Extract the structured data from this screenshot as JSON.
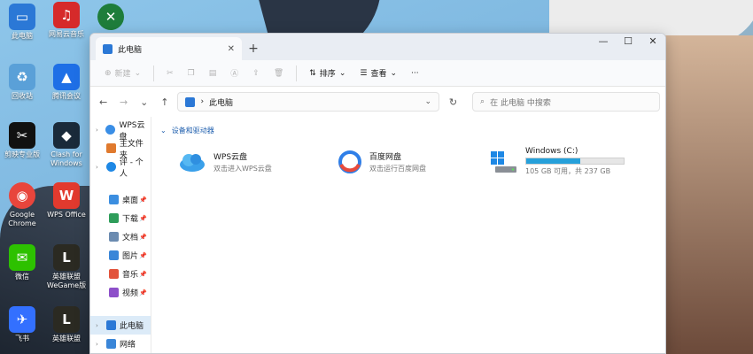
{
  "desktop": {
    "icons": [
      {
        "label": "此电脑",
        "icon": "computer-icon",
        "color": "#2b78d6"
      },
      {
        "label": "网易云音乐",
        "icon": "netease-music-icon",
        "color": "#d62a2a"
      },
      {
        "label": "",
        "icon": "game-app-icon",
        "color": "#1e7d3b"
      },
      {
        "label": "回收站",
        "icon": "recycle-bin-icon",
        "color": "#5aa0d8"
      },
      {
        "label": "腾讯会议",
        "icon": "tencent-meeting-icon",
        "color": "#1e6fe6"
      },
      {
        "label": "剪映专业版",
        "icon": "capcut-icon",
        "color": "#111111"
      },
      {
        "label": "Clash for Windows",
        "icon": "clash-cat-icon",
        "color": "#1a2a3a"
      },
      {
        "label": "Google Chrome",
        "icon": "chrome-icon",
        "color": "#e8453c"
      },
      {
        "label": "WPS Office",
        "icon": "wps-office-icon",
        "color": "#e23a2e"
      },
      {
        "label": "微信",
        "icon": "wechat-icon",
        "color": "#2dc100"
      },
      {
        "label": "英雄联盟WeGame版",
        "icon": "lol-wegame-icon",
        "color": "#2b2a22"
      },
      {
        "label": "飞书",
        "icon": "feishu-icon",
        "color": "#3370ff"
      },
      {
        "label": "英雄联盟",
        "icon": "lol-icon",
        "color": "#2b2a22"
      }
    ]
  },
  "window": {
    "tab_title": "此电脑",
    "tab_close": "✕",
    "new_tab": "+",
    "controls": {
      "minimize": "—",
      "maximize": "☐",
      "close": "✕"
    }
  },
  "commandbar": {
    "new_label": "新建",
    "sort_label": "排序",
    "view_label": "查看",
    "more": "···"
  },
  "address": {
    "path": "此电脑",
    "search_placeholder": "在 此电脑 中搜索"
  },
  "nav": {
    "top": [
      {
        "label": "WPS云盘",
        "icon": "wps-cloud-icon",
        "color": "#3a8ee6",
        "arrow": true
      },
      {
        "label": "主文件夹",
        "icon": "home-icon",
        "color": "#e07a2e",
        "arrow": false
      },
      {
        "label": "评 - 个人",
        "icon": "onedrive-icon",
        "color": "#1e88e5",
        "arrow": true
      }
    ],
    "quick": [
      {
        "label": "桌面",
        "icon": "desktop-icon",
        "color": "#3b8ee0"
      },
      {
        "label": "下载",
        "icon": "download-icon",
        "color": "#2e9d5a"
      },
      {
        "label": "文档",
        "icon": "documents-icon",
        "color": "#6b8bb0"
      },
      {
        "label": "图片",
        "icon": "pictures-icon",
        "color": "#3a86d8"
      },
      {
        "label": "音乐",
        "icon": "music-icon",
        "color": "#e2533b"
      },
      {
        "label": "视频",
        "icon": "videos-icon",
        "color": "#8d4fc9"
      }
    ],
    "bottom": [
      {
        "label": "此电脑",
        "icon": "this-pc-icon",
        "color": "#2b78d6",
        "selected": true
      },
      {
        "label": "网络",
        "icon": "network-icon",
        "color": "#3a86d8",
        "selected": false
      }
    ]
  },
  "content": {
    "group_title": "设备和驱动器",
    "items": [
      {
        "name": "WPS云盘",
        "desc": "双击进入WPS云盘",
        "icon": "wps-cloud-icon",
        "color": "#3aa0ea"
      },
      {
        "name": "百度网盘",
        "desc": "双击运行百度网盘",
        "icon": "baidu-netdisk-icon",
        "color": "#2f7fe8"
      }
    ],
    "disk": {
      "name": "Windows (C:)",
      "desc": "105 GB 可用，共 237 GB",
      "used_fraction": 0.557,
      "icon": "windows-drive-icon"
    }
  }
}
